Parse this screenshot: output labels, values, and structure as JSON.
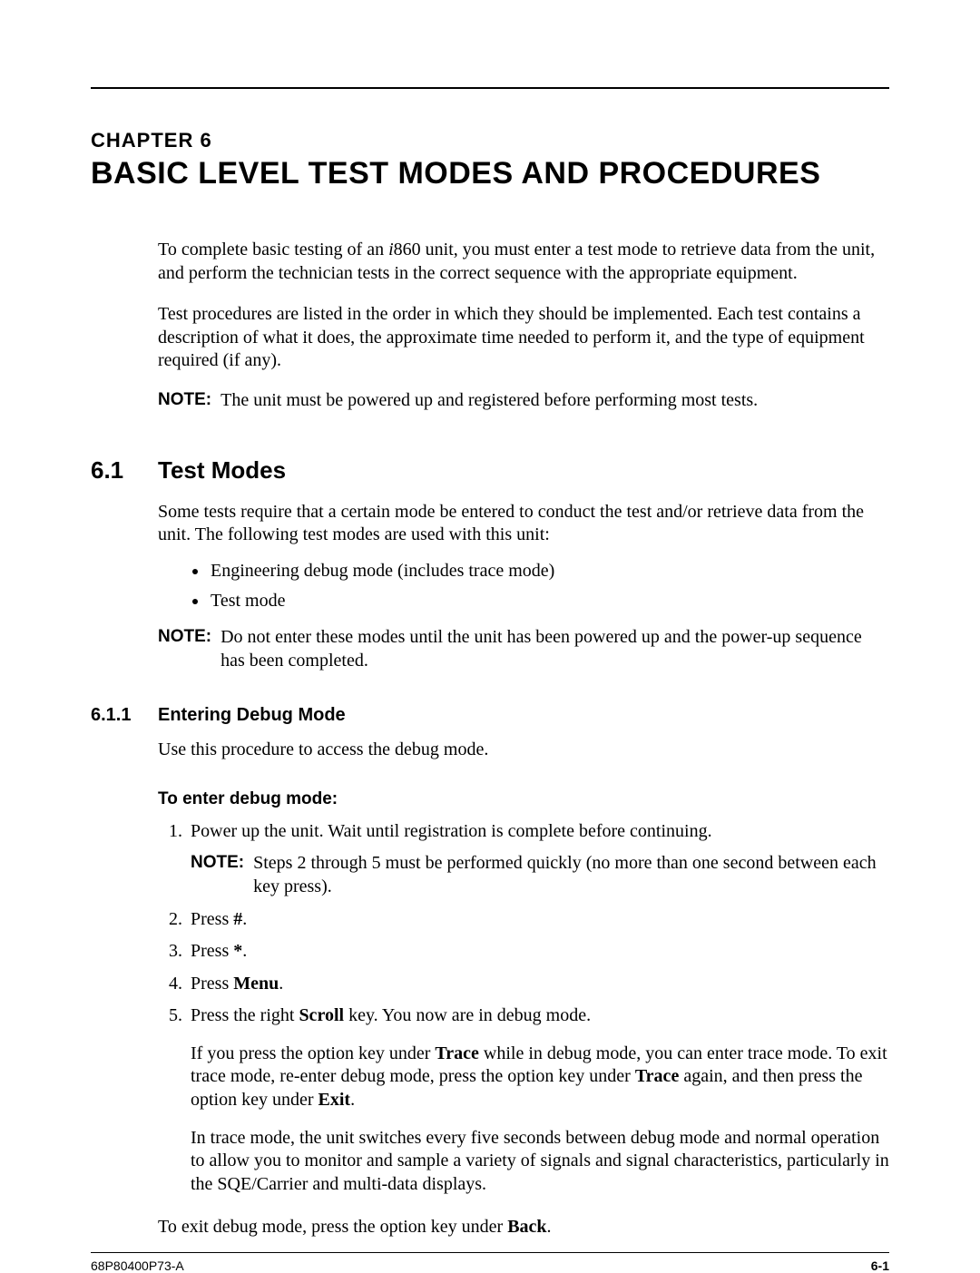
{
  "chapter_label": "CHAPTER 6",
  "chapter_title": "BASIC LEVEL TEST MODES AND PROCEDURES",
  "intro_p1_a": "To complete basic testing of an ",
  "intro_p1_i": "i",
  "intro_p1_b": "860 unit, you must enter a test mode to retrieve data from the unit, and perform the technician tests in the correct sequence with the appropriate equipment.",
  "intro_p2": "Test procedures are listed in the order in which they should be implemented. Each test contains a description of what it does, the approximate time needed to perform it, and the type of equipment required (if any).",
  "note_label": "NOTE:",
  "note1": "The unit must be powered up and registered before performing most tests.",
  "sec61_num": "6.1",
  "sec61_title": "Test Modes",
  "sec61_p1": "Some tests require that a certain mode be entered to conduct the test and/or retrieve data from the unit. The following test modes are used with this unit:",
  "bullets": {
    "b1": "Engineering debug mode (includes trace mode)",
    "b2": "Test mode"
  },
  "note2": "Do not enter these modes until the unit has been powered up and the power-up sequence has been completed.",
  "sec611_num": "6.1.1",
  "sec611_title": "Entering Debug Mode",
  "sec611_p1": "Use this procedure to access the debug mode.",
  "subhead": "To enter debug mode:",
  "steps": {
    "s1": "Power up the unit. Wait until registration is complete before continuing.",
    "s1_note": "Steps 2 through 5 must be performed quickly (no more than one second between each key press).",
    "s2_a": "Press ",
    "s2_b": "#",
    "s2_c": ".",
    "s3_a": "Press ",
    "s3_b": "*",
    "s3_c": ".",
    "s4_a": "Press ",
    "s4_b": "Menu",
    "s4_c": ".",
    "s5_a": "Press the right ",
    "s5_b": "Scroll",
    "s5_c": " key. You now are in debug mode.",
    "s5_p2_a": "If you press the option key under ",
    "s5_p2_b": "Trace",
    "s5_p2_c": " while in debug mode, you can enter trace mode. To exit trace mode, re-enter debug mode, press the option key under ",
    "s5_p2_d": "Trace",
    "s5_p2_e": " again, and then press the option key under ",
    "s5_p2_f": "Exit",
    "s5_p2_g": ".",
    "s5_p3": "In trace mode, the unit switches every five seconds between debug mode and normal operation to allow you to monitor and sample a variety of signals and signal characteristics, particularly in the SQE/Carrier and multi-data displays."
  },
  "exit_a": "To exit debug mode, press the option key under ",
  "exit_b": "Back",
  "exit_c": ".",
  "footer_left": "68P80400P73-A",
  "footer_right": "6-1"
}
